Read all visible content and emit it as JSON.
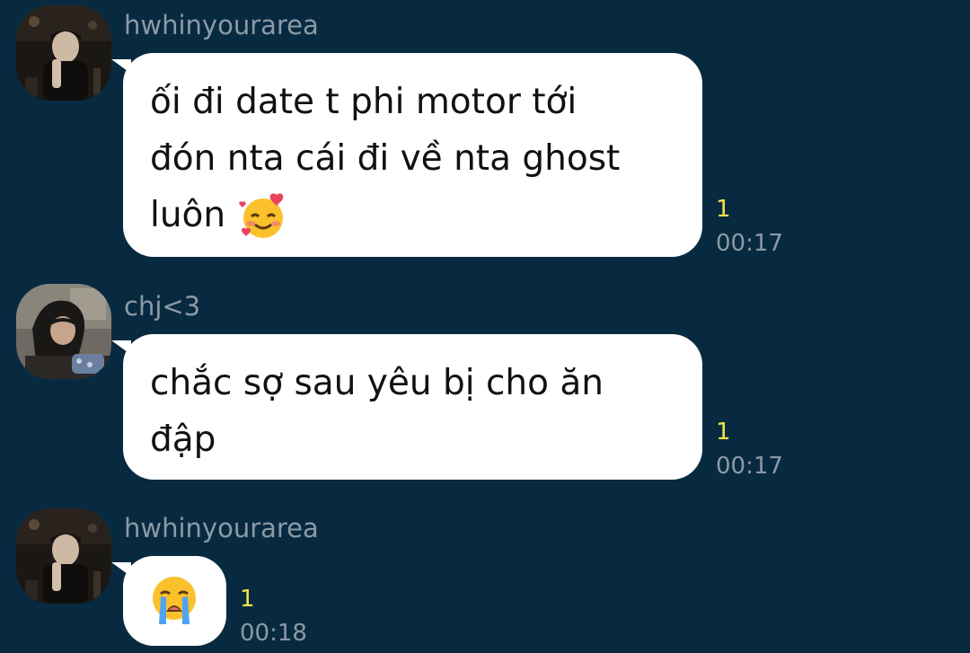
{
  "messages": [
    {
      "sender": "hwhinyourarea",
      "lines": [
        "ối đi date t phi motor tới",
        "đón nta cái đi về nta ghost",
        "luôn"
      ],
      "emoji": "smiling-face-with-hearts",
      "unread": "1",
      "time": "00:17"
    },
    {
      "sender": "chj<3",
      "lines": [
        "chắc sợ sau yêu bị cho ăn",
        "đập"
      ],
      "unread": "1",
      "time": "00:17"
    },
    {
      "sender": "hwhinyourarea",
      "emoji": "loudly-crying-face",
      "unread": "1",
      "time": "00:18"
    }
  ],
  "colors": {
    "background": "#082a40",
    "bubble": "#ffffff",
    "unread": "#f4e04d",
    "meta": "#8b9aa6"
  }
}
